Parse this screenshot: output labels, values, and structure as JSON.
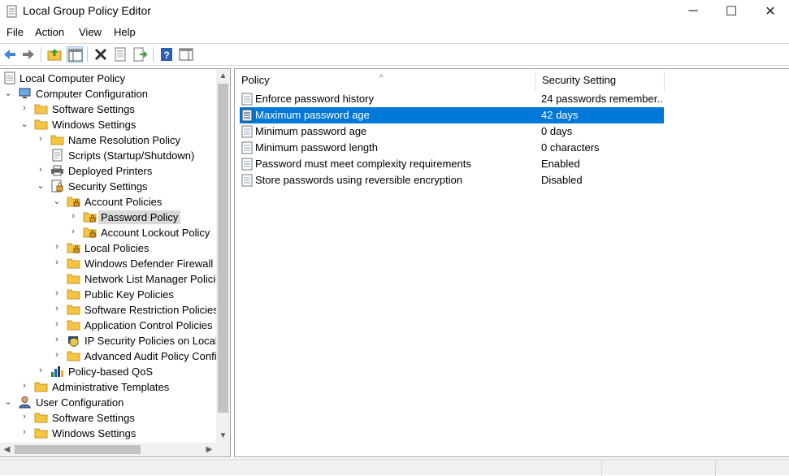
{
  "window": {
    "title": "Local Group Policy Editor",
    "minimize_glyph": "─",
    "maximize_glyph": "☐",
    "close_glyph": "✕"
  },
  "menu": [
    "File",
    "Action",
    "View",
    "Help"
  ],
  "toolbar": {
    "buttons": [
      "back-arrow-icon",
      "forward-arrow-icon",
      "up-folder-icon",
      "show-hide-tree-icon",
      "delete-icon",
      "properties-icon",
      "export-list-icon",
      "help-icon",
      "show-hide-action-pane-icon"
    ]
  },
  "tree": {
    "root": "Local Computer Policy",
    "computer_configuration": "Computer Configuration",
    "software_settings": "Software Settings",
    "windows_settings": "Windows Settings",
    "name_resolution_policy": "Name Resolution Policy",
    "scripts": "Scripts (Startup/Shutdown)",
    "deployed_printers": "Deployed Printers",
    "security_settings": "Security Settings",
    "account_policies": "Account Policies",
    "password_policy": "Password Policy",
    "account_lockout_policy": "Account Lockout Policy",
    "local_policies": "Local Policies",
    "windows_defender_firewall": "Windows Defender Firewall w",
    "network_list_manager": "Network List Manager Policie",
    "public_key_policies": "Public Key Policies",
    "software_restriction_policies": "Software Restriction Policies",
    "application_control_policies": "Application Control Policies",
    "ip_security_policies": "IP Security Policies on Local C",
    "advanced_audit_policy": "Advanced Audit Policy Confi",
    "policy_based_qos": "Policy-based QoS",
    "administrative_templates": "Administrative Templates",
    "user_configuration": "User Configuration",
    "user_software_settings": "Software Settings",
    "user_windows_settings": "Windows Settings",
    "chevron_right": "›",
    "chevron_down": "⌄"
  },
  "list": {
    "headers": {
      "policy": "Policy",
      "setting": "Security Setting"
    },
    "sort_glyph": "^",
    "rows": [
      {
        "name": "Enforce password history",
        "value": "24 passwords remember..."
      },
      {
        "name": "Maximum password age",
        "value": "42 days"
      },
      {
        "name": "Minimum password age",
        "value": "0 days"
      },
      {
        "name": "Minimum password length",
        "value": "0 characters"
      },
      {
        "name": "Password must meet complexity requirements",
        "value": "Enabled"
      },
      {
        "name": "Store passwords using reversible encryption",
        "value": "Disabled"
      }
    ]
  },
  "scroll": {
    "up": "▲",
    "down": "▼",
    "left": "◀",
    "right": "▶"
  },
  "colors": {
    "selection": "#0078d7",
    "tree_selection": "#d9d9d9",
    "folder": "#f5c542"
  }
}
